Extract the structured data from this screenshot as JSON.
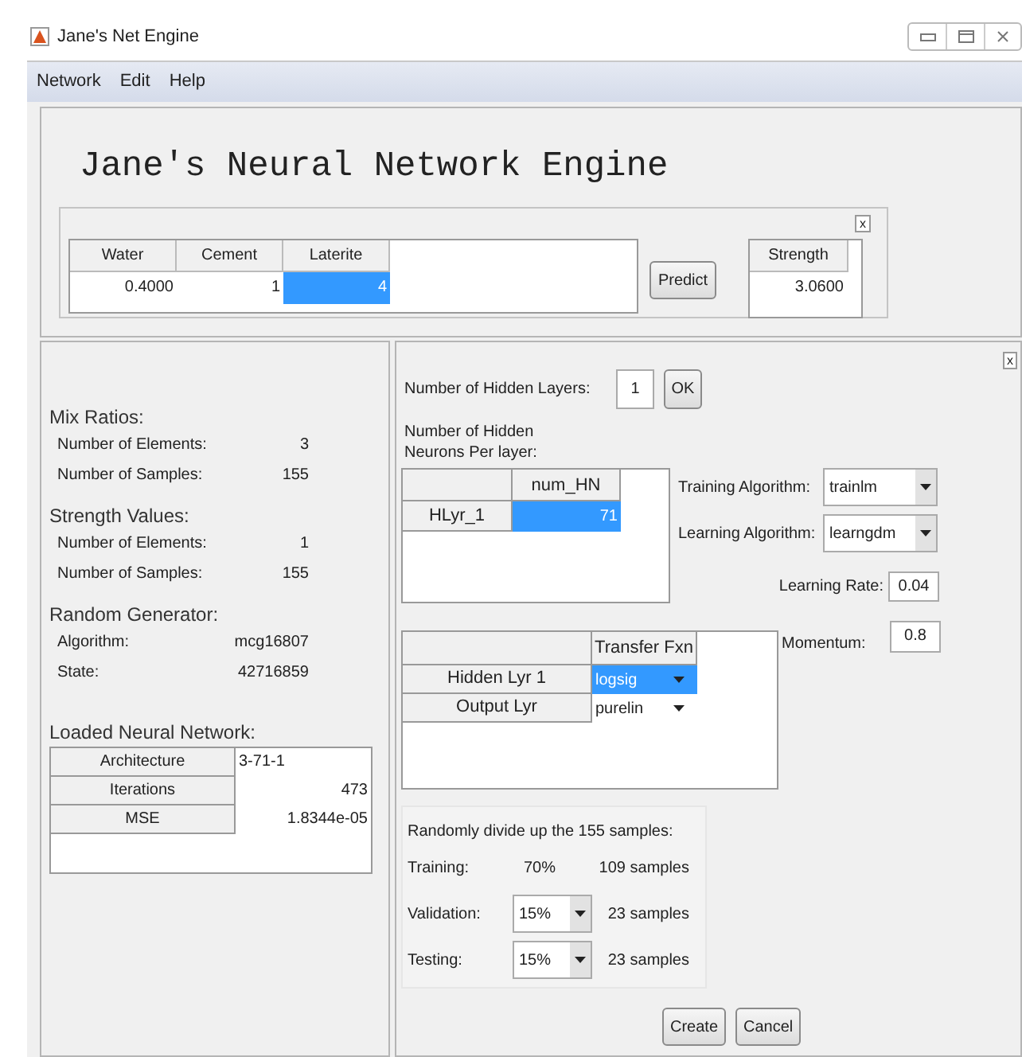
{
  "window": {
    "title": "Jane's Net Engine"
  },
  "menu": [
    "Network",
    "Edit",
    "Help"
  ],
  "heading": "Jane's Neural Network Engine",
  "prediction": {
    "close": "x",
    "inputs": {
      "columns": [
        "Water",
        "Cement",
        "Laterite"
      ],
      "cells": [
        {
          "value": "0.4000",
          "selected": false
        },
        {
          "value": "1",
          "selected": false
        },
        {
          "value": "4",
          "selected": true
        }
      ]
    },
    "predict_button": "Predict",
    "output": {
      "column": "Strength",
      "value": "3.0600"
    }
  },
  "info": {
    "sections": [
      {
        "title": "Mix Ratios:",
        "rows": [
          {
            "label": "Number of Elements:",
            "value": "3"
          },
          {
            "label": "Number of Samples:",
            "value": "155"
          }
        ]
      },
      {
        "title": "Strength Values:",
        "rows": [
          {
            "label": "Number of Elements:",
            "value": "1"
          },
          {
            "label": "Number of Samples:",
            "value": "155"
          }
        ]
      },
      {
        "title": "Random Generator:",
        "rows": [
          {
            "label": "Algorithm:",
            "value": "mcg16807"
          },
          {
            "label": "State:",
            "value": "42716859"
          }
        ]
      }
    ],
    "network": {
      "title": "Loaded Neural Network:",
      "rows": [
        {
          "label": "Architecture",
          "value": "3-71-1"
        },
        {
          "label": "Iterations",
          "value": "473"
        },
        {
          "label": "MSE",
          "value": "1.8344e-05"
        }
      ]
    }
  },
  "create_panel": {
    "close": "x",
    "hidden_layers": {
      "label": "Number of Hidden Layers:",
      "value": "1",
      "button": "OK"
    },
    "neurons": {
      "label": "Number of Hidden Neurons Per layer:",
      "column": "num_HN",
      "rows": [
        {
          "label": "HLyr_1",
          "value": "71",
          "selected": true
        }
      ]
    },
    "training_algorithm": {
      "label": "Training Algorithm:",
      "value": "trainlm"
    },
    "learning_algorithm": {
      "label": "Learning Algorithm:",
      "value": "learngdm"
    },
    "learning_rate": {
      "label": "Learning Rate:",
      "value": "0.04"
    },
    "momentum": {
      "label": "Momentum:",
      "value": "0.8"
    },
    "transfer": {
      "column": "Transfer Fxn",
      "rows": [
        {
          "label": "Hidden Lyr 1",
          "value": "logsig",
          "selected": true
        },
        {
          "label": "Output Lyr",
          "value": "purelin",
          "selected": false
        }
      ]
    },
    "divide": {
      "title": "Randomly divide up the 155 samples:",
      "rows": [
        {
          "kind": "text",
          "label": "Training:",
          "value": "70%",
          "samples": "109 samples"
        },
        {
          "kind": "dropdown",
          "label": "Validation:",
          "value": "15%",
          "samples": "23 samples"
        },
        {
          "kind": "dropdown",
          "label": "Testing:",
          "value": "15%",
          "samples": "23 samples"
        }
      ]
    },
    "buttons": [
      "Create",
      "Cancel"
    ]
  }
}
